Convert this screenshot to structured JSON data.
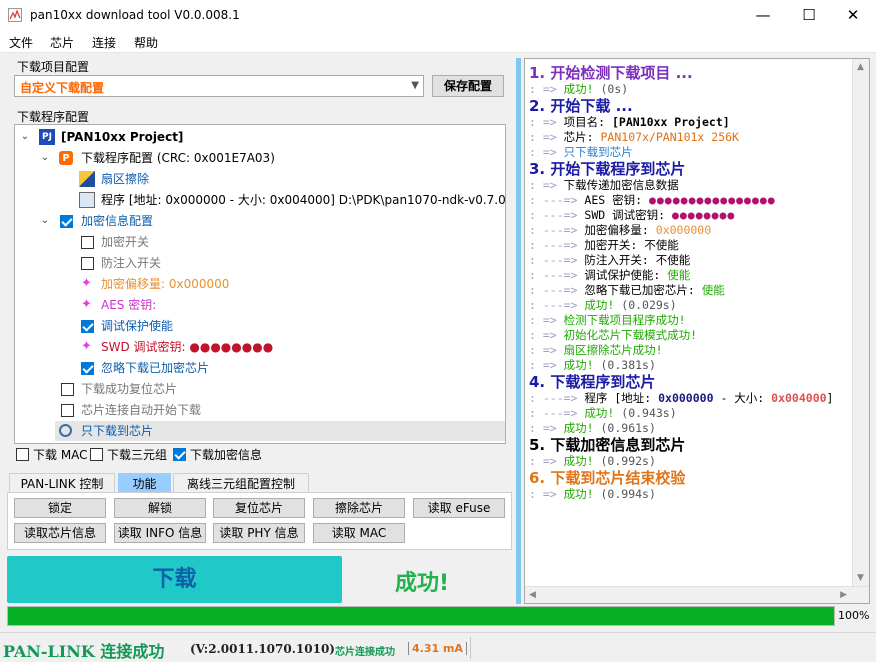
{
  "window": {
    "title": "pan10xx download tool V0.0.008.1",
    "min": "—",
    "max": "☐",
    "close": "✕"
  },
  "menu": [
    "文件",
    "芯片",
    "连接",
    "帮助"
  ],
  "download_config": {
    "group_title": "下载项目配置",
    "selected": "自定义下载配置",
    "save_label": "保存配置"
  },
  "program_config": {
    "group_title": "下载程序配置",
    "root": "[PAN10xx Project]",
    "prog_cfg": "下载程序配置 (CRC: 0x001E7A03)",
    "erase": "扇区擦除",
    "program": "程序 [地址: 0x000000 - 大小: 0x004000] D:\\PDK\\pan1070-ndk-v0.7.0...",
    "encrypt_cfg": "加密信息配置",
    "enc_switch": "加密开关",
    "anti_inject": "防注入开关",
    "enc_offset": "加密偏移量: 0x000000",
    "aes_key": "AES 密钥:",
    "debug_protect": "调试保护使能",
    "swd_key": "SWD 调试密钥: ●●●●●●●●",
    "skip_encrypted": "忽略下载已加密芯片",
    "reset_after": "下载成功复位芯片",
    "auto_start": "芯片连接自动开始下载",
    "only_download": "只下载到芯片",
    "download_mac": "下载 MAC",
    "download_triple": "下载三元组",
    "download_encrypt": "下载加密信息"
  },
  "tabs": [
    "PAN-LINK 控制",
    "功能",
    "离线三元组配置控制"
  ],
  "functions": {
    "row1": [
      "锁定",
      "解锁",
      "复位芯片",
      "擦除芯片",
      "读取 eFuse"
    ],
    "row2": [
      "读取芯片信息",
      "读取 INFO 信息",
      "读取 PHY 信息",
      "读取 MAC"
    ]
  },
  "download_button": "下载",
  "result": "成功!",
  "log": {
    "h1": "1. 开始检测下载项目 ...",
    "l1": "成功!",
    "t1": "(0s)",
    "h2": "2. 开始下载 ...",
    "proj_label": "项目名:",
    "proj_name": "[PAN10xx Project]",
    "chip_label": "芯片:",
    "chip_name": "PAN107x/PAN101x 256K",
    "only_dl": "只下载到芯片",
    "h3": "3. 开始下载程序到芯片",
    "sub3": "下载传递加密信息数据",
    "aes_label": "AES 密钥:",
    "aes_dots": "●●●●●●●●●●●●●●●●",
    "swd_label": "SWD 调试密钥:",
    "swd_dots": "●●●●●●●●",
    "offset_label": "加密偏移量:",
    "offset_val": "0x000000",
    "enc_sw": "加密开关: 不使能",
    "anti": "防注入开关: 不使能",
    "dbg_label": "调试保护使能:",
    "dbg_val": "使能",
    "skip_label": "忽略下载已加密芯片:",
    "skip_val": "使能",
    "ok3": "成功!",
    "t3a": "(0.029s)",
    "detect_ok": "检测下载项目程序成功!",
    "init_ok": "初始化芯片下载模式成功!",
    "erase_ok": "扇区擦除芯片成功!",
    "ok3b": "成功!",
    "t3b": "(0.381s)",
    "h4": "4. 下载程序到芯片",
    "prog_pre": "程序 [地址:",
    "prog_addr": "0x000000",
    "prog_mid": "- 大小:",
    "prog_size": "0x004000",
    "prog_end": "]",
    "ok4a": "成功!",
    "t4a": "(0.943s)",
    "ok4b": "成功!",
    "t4b": "(0.961s)",
    "h5": "5. 下载加密信息到芯片",
    "ok5": "成功!",
    "t5": "(0.992s)",
    "h6": "6. 下载到芯片结束校验",
    "ok6": "成功!",
    "t6": "(0.994s)"
  },
  "progress": {
    "value": 1.0,
    "label": "100%"
  },
  "status": {
    "pan": "PAN-LINK 连接成功",
    "version": "(V:2.0011.1070.1010)",
    "chip": "芯片连接成功",
    "current": "4.31 mA"
  },
  "colors": {
    "accent": "#0078d7",
    "progress": "#06b025",
    "download_btn": "#20c8c8",
    "success": "#22b14c"
  }
}
